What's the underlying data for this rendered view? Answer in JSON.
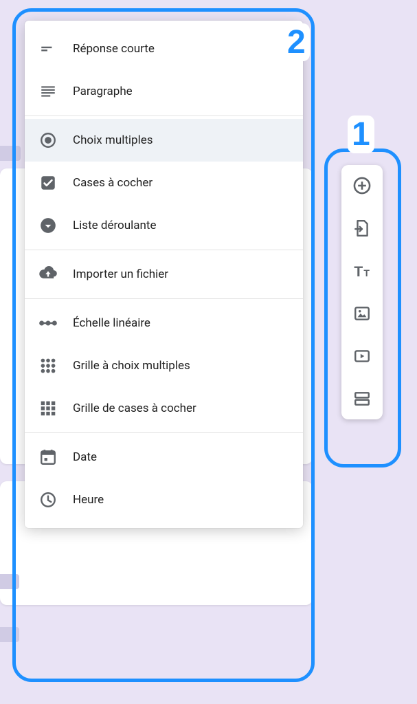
{
  "menu": {
    "groups": [
      [
        {
          "key": "short-answer",
          "label": "Réponse courte",
          "selected": false
        },
        {
          "key": "paragraph",
          "label": "Paragraphe",
          "selected": false
        }
      ],
      [
        {
          "key": "multiple-choice",
          "label": "Choix multiples",
          "selected": true
        },
        {
          "key": "checkboxes",
          "label": "Cases à cocher",
          "selected": false
        },
        {
          "key": "dropdown",
          "label": "Liste déroulante",
          "selected": false
        }
      ],
      [
        {
          "key": "file-upload",
          "label": "Importer un fichier",
          "selected": false
        }
      ],
      [
        {
          "key": "linear-scale",
          "label": "Échelle linéaire",
          "selected": false
        },
        {
          "key": "multiple-choice-grid",
          "label": "Grille à choix multiples",
          "selected": false
        },
        {
          "key": "checkbox-grid",
          "label": "Grille de cases à cocher",
          "selected": false
        }
      ],
      [
        {
          "key": "date",
          "label": "Date",
          "selected": false
        },
        {
          "key": "time",
          "label": "Heure",
          "selected": false
        }
      ]
    ]
  },
  "toolbar": {
    "items": [
      {
        "key": "add-question"
      },
      {
        "key": "import-questions"
      },
      {
        "key": "add-title"
      },
      {
        "key": "add-image"
      },
      {
        "key": "add-video"
      },
      {
        "key": "add-section"
      }
    ]
  },
  "callouts": {
    "one": "1",
    "two": "2"
  }
}
